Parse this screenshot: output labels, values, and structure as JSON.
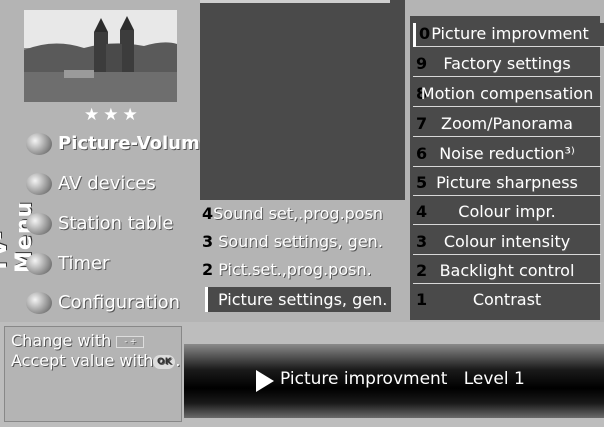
{
  "sidebar": {
    "rating": "★★★",
    "vertical_title": "TV-Menu",
    "items": [
      {
        "label": "Picture-Volume",
        "selected": true
      },
      {
        "label": "AV devices",
        "selected": false
      },
      {
        "label": "Station table",
        "selected": false
      },
      {
        "label": "Timer",
        "selected": false
      },
      {
        "label": "Configuration",
        "selected": false
      }
    ]
  },
  "middle": {
    "items": [
      {
        "num": "4",
        "label": "Sound set,.prog.posn"
      },
      {
        "num": "3",
        "label": "Sound settings, gen."
      },
      {
        "num": "2",
        "label": "Pict.set.,prog.posn."
      },
      {
        "num": "1",
        "label": "Picture settings, gen.",
        "selected": true
      }
    ]
  },
  "right": {
    "items": [
      {
        "num": "0",
        "label": "Picture improvment",
        "selected": true
      },
      {
        "num": "9",
        "label": "Factory settings"
      },
      {
        "num": "8",
        "label": "Motion compensation"
      },
      {
        "num": "7",
        "label": "Zoom/Panorama"
      },
      {
        "num": "6",
        "label": "Noise reduction³⁾"
      },
      {
        "num": "5",
        "label": "Picture sharpness"
      },
      {
        "num": "4",
        "label": "Colour impr."
      },
      {
        "num": "3",
        "label": "Colour intensity"
      },
      {
        "num": "2",
        "label": "Backlight control"
      },
      {
        "num": "1",
        "label": "Contrast"
      }
    ]
  },
  "help": {
    "line1": "Change with",
    "line2": "Accept value with",
    "minus_plus": "- +",
    "ok": "OK"
  },
  "status": {
    "setting": "Picture improvment",
    "value": "Level 1"
  }
}
